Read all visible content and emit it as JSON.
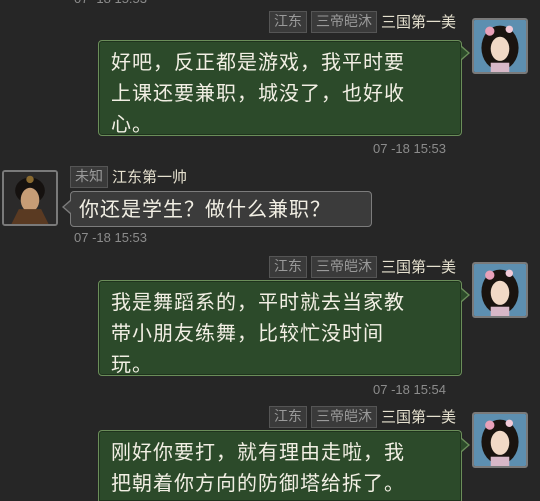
{
  "messages": [
    {
      "side": "right",
      "tags": [
        "江东",
        "三帝皑沐"
      ],
      "name": "三国第一美",
      "text": "好吧，反正都是游戏，我平时要\n上课还要兼职，城没了，也好收\n心。",
      "time": "07 -18 15:53",
      "avatar": "female-avatar"
    },
    {
      "side": "left",
      "tags": [
        "未知"
      ],
      "name": "江东第一帅",
      "text": "你还是学生？做什么兼职？",
      "time": "07 -18 15:53",
      "avatar": "male-avatar"
    },
    {
      "side": "right",
      "tags": [
        "江东",
        "三帝皑沐"
      ],
      "name": "三国第一美",
      "text": "我是舞蹈系的，平时就去当家教\n带小朋友练舞，比较忙没时间\n玩。",
      "time": "07 -18 15:54",
      "avatar": "female-avatar"
    },
    {
      "side": "right",
      "tags": [
        "江东",
        "三帝皑沐"
      ],
      "name": "三国第一美",
      "text": "刚好你要打，就有理由走啦，我\n把朝着你方向的防御塔给拆了。",
      "time": "",
      "avatar": "female-avatar"
    }
  ],
  "colors": {
    "background": "#262626",
    "bubble_self": "#2c4a2a",
    "bubble_other": "#3b3b3b",
    "timestamp": "#8c8c8c"
  }
}
